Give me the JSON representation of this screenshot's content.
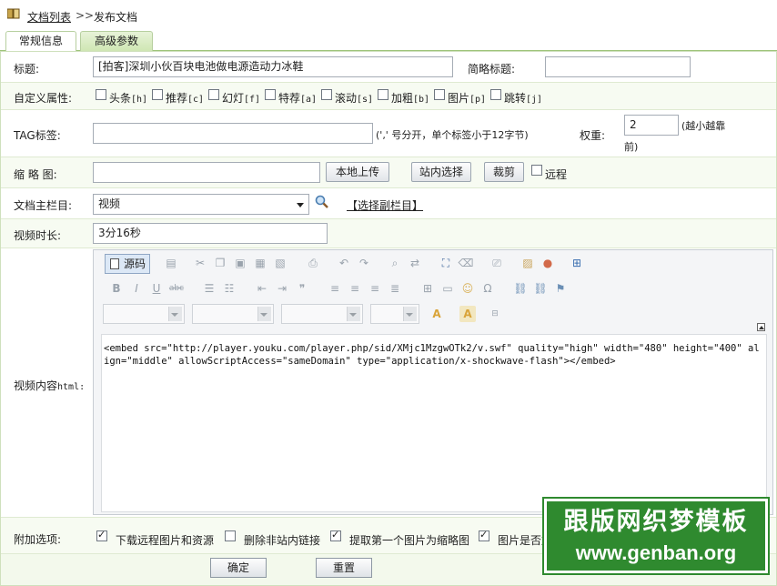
{
  "breadcrumb": {
    "list_link": "文档列表",
    "separator": ">>",
    "current": "发布文档"
  },
  "tabs": [
    {
      "label": "常规信息"
    },
    {
      "label": "高级参数"
    }
  ],
  "title_row": {
    "label": "标题:",
    "value": "[拍客]深圳小伙百块电池做电源造动力冰鞋",
    "short_label": "简略标题:",
    "short_value": ""
  },
  "attrs": {
    "label": "自定义属性:",
    "items": [
      {
        "label": "头条",
        "code": "[h]"
      },
      {
        "label": "推荐",
        "code": "[c]"
      },
      {
        "label": "幻灯",
        "code": "[f]"
      },
      {
        "label": "特荐",
        "code": "[a]"
      },
      {
        "label": "滚动",
        "code": "[s]"
      },
      {
        "label": "加粗",
        "code": "[b]"
      },
      {
        "label": "图片",
        "code": "[p]"
      },
      {
        "label": "跳转",
        "code": "[j]"
      }
    ]
  },
  "tag_row": {
    "label": "TAG标签:",
    "value": "",
    "hint": "(',' 号分开，单个标签小于12字节)",
    "weight_label": "权重:",
    "weight_value": "2",
    "weight_hint_1": "(越小越靠",
    "weight_hint_2": "前)"
  },
  "thumb_row": {
    "label": "缩 略 图:",
    "value": "",
    "upload": "本地上传",
    "site_select": "站内选择",
    "crop": "裁剪",
    "remote": "远程"
  },
  "column_row": {
    "label": "文档主栏目:",
    "value": "视频",
    "sub_link": "【选择副栏目】"
  },
  "duration_row": {
    "label": "视频时长:",
    "value": "3分16秒"
  },
  "content_row": {
    "label": "视频内容",
    "label_code": "html:",
    "source_button": "源码",
    "html": "<embed src=\"http://player.youku.com/player.php/sid/XMjc1MzgwOTk2/v.swf\" quality=\"high\" width=\"480\" height=\"400\" align=\"middle\" allowScriptAccess=\"sameDomain\" type=\"application/x-shockwave-flash\"></embed>"
  },
  "options_row": {
    "label": "附加选项:",
    "items": [
      {
        "label": "下载远程图片和资源",
        "checked": true
      },
      {
        "label": "删除非站内链接",
        "checked": false
      },
      {
        "label": "提取第一个图片为缩略图",
        "checked": true
      },
      {
        "label": "图片是否加",
        "checked": true
      }
    ]
  },
  "footer": {
    "confirm": "确定",
    "reset": "重置"
  },
  "watermark": {
    "line1": "跟版网织梦模板",
    "line2": "www.genban.org"
  },
  "colors": {
    "accent": "#2f8a2f",
    "tab_border": "#9ec47a"
  }
}
